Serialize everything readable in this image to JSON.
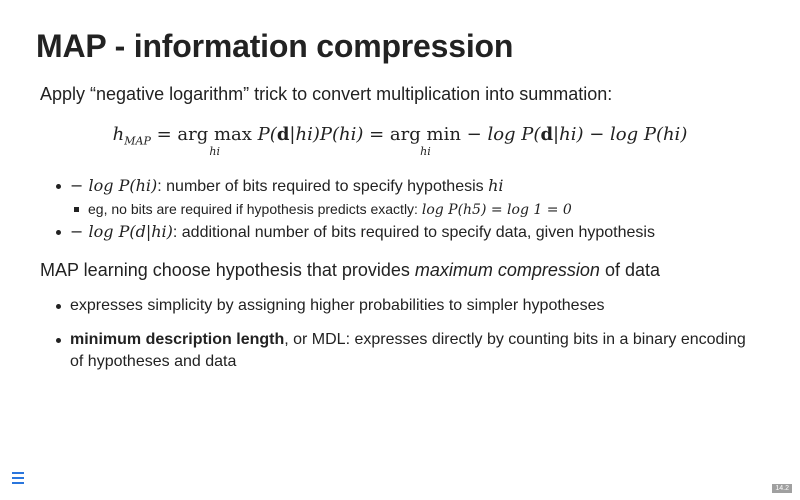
{
  "slide": {
    "title": "MAP - information compression",
    "intro": "Apply “negative logarithm” trick to convert multiplication into summation:",
    "equation": {
      "lhs_h": "h",
      "lhs_sub": "MAP",
      "eq1": "=",
      "argmax_top": "arg max",
      "argmax_sub": "hi",
      "term1": "P(",
      "bold_d": "d",
      "term1b": "|hi)P(hi)",
      "eq2": "=",
      "argmin_top": "arg min",
      "argmin_sub": "hi",
      "term2": "− log P(",
      "bold_d2": "d",
      "term2b": "|hi) − log P(hi)"
    },
    "bullets": [
      {
        "math": "− log P(hi)",
        "text": ": number of bits required to specify hypothesis ",
        "math2": "hi"
      },
      {
        "text": "eg, no bits are required if hypothesis predicts exactly: ",
        "math": "log P(h5) = log 1 = 0"
      },
      {
        "math": "− log P(d|hi)",
        "text": ": additional number of bits required to specify data, given hypothesis"
      }
    ],
    "section_pre": "MAP learning choose hypothesis that provides ",
    "section_em": "maximum compression",
    "section_post": " of data",
    "bullets2": [
      {
        "text": "expresses simplicity by assigning higher probabilities to simpler hypotheses"
      },
      {
        "bold": "minimum description length",
        "text": ", or MDL: expresses directly by counting bits in a binary encoding of hypotheses and data"
      }
    ],
    "slide_number": "14.2",
    "menu_icon": "hamburger-menu-icon"
  },
  "colors": {
    "text": "#222222",
    "menu_icon": "#2a76dd",
    "slide_number_bg": "#a0a0a0"
  }
}
